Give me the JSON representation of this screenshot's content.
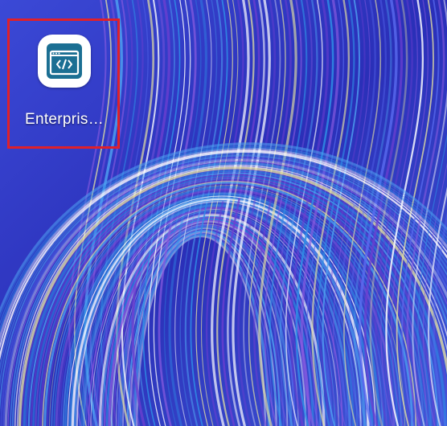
{
  "home_screen": {
    "wallpaper": {
      "style": "blue swirl streaks",
      "base_color": "#2a2fb8",
      "accent_colors": [
        "#4ea0f0",
        "#8a5be0",
        "#e8e4a0",
        "#ffffff"
      ]
    },
    "apps": [
      {
        "label": "Enterpris…",
        "icon": "code-window-icon",
        "icon_background": "#ffffff",
        "icon_color": "#1b6f93"
      }
    ],
    "highlight_color": "#e0202a"
  }
}
